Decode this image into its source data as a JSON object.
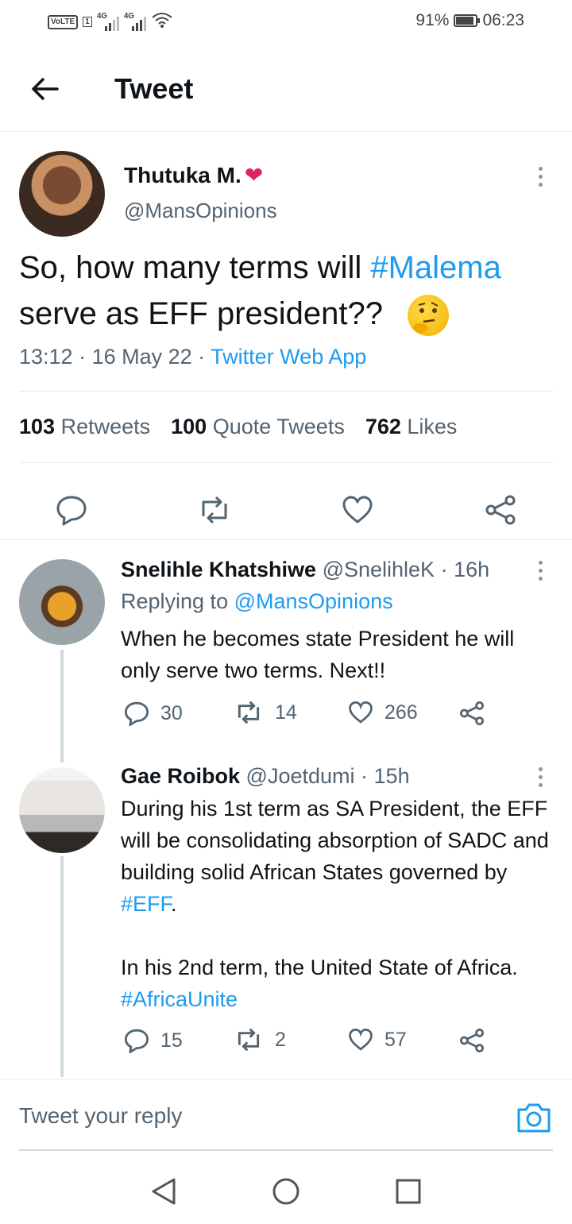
{
  "status_bar": {
    "network_badge": "VoLTE",
    "sim_number": "1",
    "signal_tag_1": "4G",
    "signal_tag_2": "4G",
    "battery_percent": "91%",
    "battery_level": 0.91,
    "time": "06:23"
  },
  "header": {
    "title": "Tweet",
    "back_icon": "arrow-left-icon"
  },
  "main_tweet": {
    "author_name": "Thutuka M.",
    "author_emoji": "❤",
    "handle": "@MansOpinions",
    "text_before": "So, how many terms will ",
    "hashtag": "#Malema",
    "text_after": " serve as EFF president?? ",
    "time": "13:12",
    "date": "16 May 22",
    "source": "Twitter Web App",
    "stats": {
      "retweets_count": "103",
      "retweets_label": "Retweets",
      "quotes_count": "100",
      "quotes_label": "Quote Tweets",
      "likes_count": "762",
      "likes_label": "Likes"
    },
    "action_icons": [
      "reply-icon",
      "retweet-icon",
      "like-icon",
      "share-icon"
    ]
  },
  "replies": [
    {
      "name": "Snelihle Khatshiwe",
      "handle": "@SnelihleK",
      "age": "16h",
      "replying_label": "Replying to",
      "replying_to": "@MansOpinions",
      "text": "When he becomes state President he will only serve two terms. Next!!",
      "reply_count": "30",
      "retweet_count": "14",
      "like_count": "266"
    },
    {
      "name": "Gae Roibok",
      "handle": "@Joetdumi",
      "age": "15h",
      "text_part1": "During his 1st term as SA President, the EFF will be consolidating absorption of SADC and building solid African States governed by ",
      "hashtag1": "#EFF",
      "text_part2": ".",
      "text_part3": "In his 2nd term, the United State of Africa. ",
      "hashtag2": "#AfricaUnite",
      "reply_count": "15",
      "retweet_count": "2",
      "like_count": "57"
    }
  ],
  "reply_bar": {
    "placeholder": "Tweet your reply",
    "camera_icon": "camera-icon"
  },
  "nav": {
    "icons": [
      "back-triangle-icon",
      "home-circle-icon",
      "recents-square-icon"
    ]
  },
  "colors": {
    "accent": "#1d9bf0",
    "secondary_text": "#536471",
    "heart": "#e0245e"
  }
}
